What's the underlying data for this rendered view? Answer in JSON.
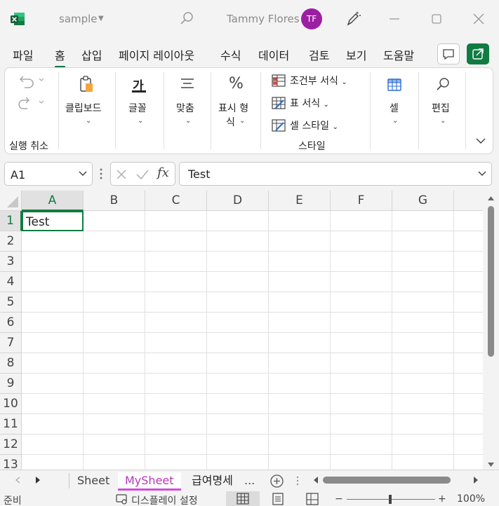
{
  "titlebar": {
    "app_icon": "excel-logo-icon",
    "doc_title": "sample",
    "doc_menu_icon": "caret-down-icon",
    "search_icon": "search-icon",
    "user_name": "Tammy Flores",
    "avatar_initials": "TF",
    "avatar_color": "#9c1fa3",
    "copilot_icon": "pen-sparkle-icon",
    "minimize_icon": "minimize-icon",
    "maximize_icon": "maximize-icon",
    "close_icon": "close-icon"
  },
  "tabs": [
    {
      "label": "파일"
    },
    {
      "label": "홈",
      "active": true
    },
    {
      "label": "삽입"
    },
    {
      "label": "페이지 레이아웃"
    },
    {
      "label": "수식"
    },
    {
      "label": "데이터"
    },
    {
      "label": "검토"
    },
    {
      "label": "보기"
    },
    {
      "label": "도움말"
    }
  ],
  "ribbon": {
    "undo_group_label": "실행 취소",
    "clipboard_label": "클립보드",
    "font_label": "글꼴",
    "font_icon_text": "가",
    "align_label": "맞춤",
    "number_label_1": "표시 형",
    "number_label_2": "식",
    "number_icon_text": "%",
    "conditional_format": "조건부 서식",
    "table_format": "표 서식",
    "cell_style": "셀 스타일",
    "styles_group_label": "스타일",
    "cells_label": "셀",
    "editing_label": "편집"
  },
  "formula_bar": {
    "name_box": "A1",
    "fx_label": "fx",
    "formula_value": "Test"
  },
  "grid": {
    "columns": [
      "A",
      "B",
      "C",
      "D",
      "E",
      "F",
      "G"
    ],
    "rows": [
      "1",
      "2",
      "3",
      "4",
      "5",
      "6",
      "7",
      "8",
      "9",
      "10",
      "11",
      "12",
      "13"
    ],
    "selected_cell": "A1",
    "cells": {
      "A1": "Test"
    }
  },
  "sheet_tabs": [
    {
      "label": "Sheet"
    },
    {
      "label": "MySheet",
      "active": true
    },
    {
      "label": "급여명세"
    }
  ],
  "sheet_more": "...",
  "statusbar": {
    "ready": "준비",
    "display_settings": "디스플레이 설정",
    "zoom": "100%",
    "zoom_minus": "−",
    "zoom_plus": "+"
  },
  "colors": {
    "accent": "#107c41",
    "active_sheet_tab": "#d34bd9"
  }
}
